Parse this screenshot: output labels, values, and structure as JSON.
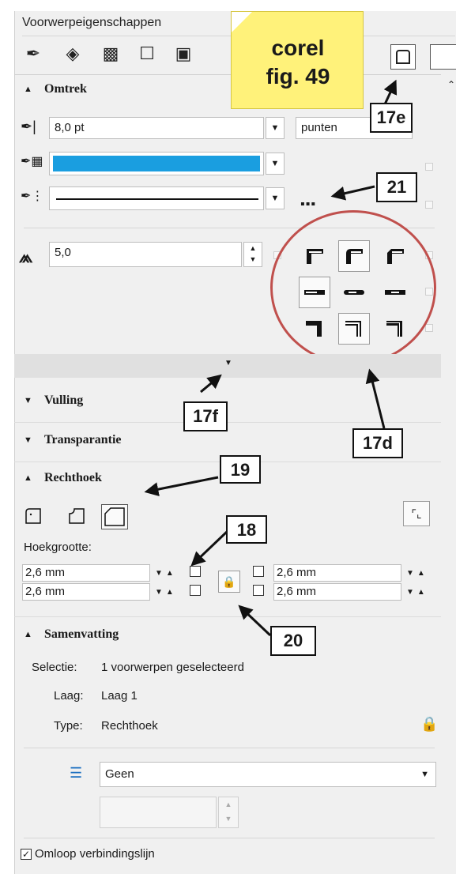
{
  "panel": {
    "title": "Voorwerpeigenschappen"
  },
  "tabs": [
    "pen-nib-icon",
    "fill-bucket-icon",
    "checker-icon",
    "rectangle-icon",
    "image-icon"
  ],
  "sticky_note": {
    "line1": "corel",
    "line2": "fig. 49",
    "color": "#fff27a"
  },
  "outline": {
    "header": "Omtrek",
    "width_value": "8,0 pt",
    "units_value": "punten",
    "color": "#1a9ee0",
    "miter_value": "5,0"
  },
  "sections": {
    "fill": "Vulling",
    "transparency": "Transparantie",
    "rectangle": "Rechthoek",
    "summary": "Samenvatting"
  },
  "rectangle": {
    "corner_label": "Hoekgrootte:",
    "tl": "2,6 mm",
    "bl": "2,6 mm",
    "tr": "2,6 mm",
    "br": "2,6 mm"
  },
  "summary": {
    "selection_label": "Selectie:",
    "selection_value": "1 voorwerpen geselecteerd",
    "layer_label": "Laag:",
    "layer_value": "Laag 1",
    "type_label": "Type:",
    "type_value": "Rechthoek",
    "wrap_value": "Geen",
    "checkbox_label": "Omloop verbindingslijn"
  },
  "callouts": {
    "c17e": "17e",
    "c21": "21",
    "c17f": "17f",
    "c17d": "17d",
    "c19": "19",
    "c18": "18",
    "c20": "20"
  },
  "colors": {
    "annotation_circle": "#c0504d",
    "accent": "#1a9ee0"
  }
}
